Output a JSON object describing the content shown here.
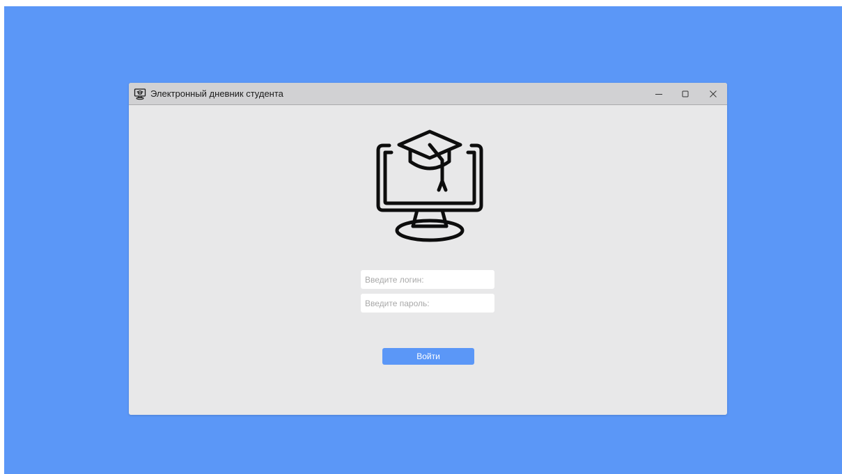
{
  "window": {
    "title": "Электронный дневник студента",
    "controls": {
      "minimize_icon": "minimize-icon",
      "maximize_icon": "maximize-icon",
      "close_icon": "close-icon"
    }
  },
  "logo": {
    "icon": "graduation-cap-monitor-icon"
  },
  "form": {
    "login_placeholder": "Введите логин:",
    "login_value": "",
    "password_placeholder": "Введите пароль:",
    "password_value": "",
    "submit_label": "Войти"
  },
  "colors": {
    "desktop_background": "#5b97f7",
    "window_background": "#e8e8e9",
    "titlebar_background": "#d1d1d3",
    "accent": "#5b97f7"
  }
}
